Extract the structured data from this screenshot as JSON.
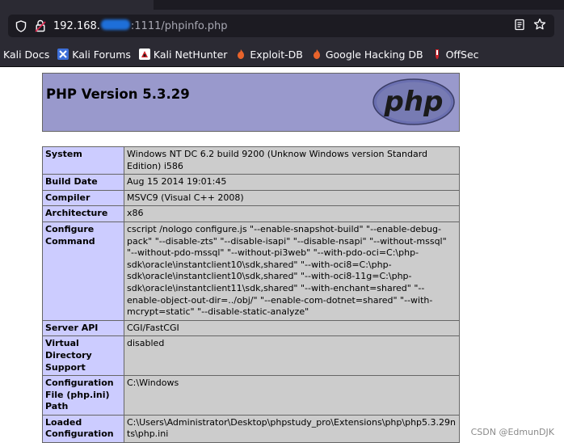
{
  "browser": {
    "url": {
      "host_prefix": "192.168.",
      "host_suffix": ":1111",
      "path": "/phpinfo.php"
    },
    "bookmarks": [
      {
        "label": "Kali Docs",
        "icon": "kali-icon"
      },
      {
        "label": "Kali Forums",
        "icon": "kali-forums-icon"
      },
      {
        "label": "Kali NetHunter",
        "icon": "nethunter-icon"
      },
      {
        "label": "Exploit-DB",
        "icon": "exploit-db-icon"
      },
      {
        "label": "Google Hacking DB",
        "icon": "ghdb-icon"
      },
      {
        "label": "OffSec",
        "icon": "offsec-icon"
      }
    ]
  },
  "page": {
    "title": "PHP Version 5.3.29",
    "logo_text": "php",
    "rows": [
      {
        "key": "System",
        "value": "Windows NT DC 6.2 build 9200 (Unknow Windows version Standard Edition) i586"
      },
      {
        "key": "Build Date",
        "value": "Aug 15 2014 19:01:45"
      },
      {
        "key": "Compiler",
        "value": "MSVC9 (Visual C++ 2008)"
      },
      {
        "key": "Architecture",
        "value": "x86"
      },
      {
        "key": "Configure Command",
        "value": "cscript /nologo configure.js \"--enable-snapshot-build\" \"--enable-debug-pack\" \"--disable-zts\" \"--disable-isapi\" \"--disable-nsapi\" \"--without-mssql\" \"--without-pdo-mssql\" \"--without-pi3web\" \"--with-pdo-oci=C:\\php-sdk\\oracle\\instantclient10\\sdk,shared\" \"--with-oci8=C:\\php-sdk\\oracle\\instantclient10\\sdk,shared\" \"--with-oci8-11g=C:\\php-sdk\\oracle\\instantclient11\\sdk,shared\" \"--with-enchant=shared\" \"--enable-object-out-dir=../obj/\" \"--enable-com-dotnet=shared\" \"--with-mcrypt=static\" \"--disable-static-analyze\""
      },
      {
        "key": "Server API",
        "value": "CGI/FastCGI"
      },
      {
        "key": "Virtual Directory Support",
        "value": "disabled"
      },
      {
        "key": "Configuration File (php.ini) Path",
        "value": "C:\\Windows"
      },
      {
        "key": "Loaded Configuration",
        "value": "C:\\Users\\Administrator\\Desktop\\phpstudy_pro\\Extensions\\php\\php5.3.29nts\\php.ini"
      }
    ]
  },
  "watermark": "CSDN @EdmunDJK",
  "colors": {
    "header_bg": "#9999cc",
    "key_bg": "#ccccff",
    "value_bg": "#cccccc",
    "chrome_bg": "#2b2a33",
    "urlbar_bg": "#1c1b22"
  }
}
